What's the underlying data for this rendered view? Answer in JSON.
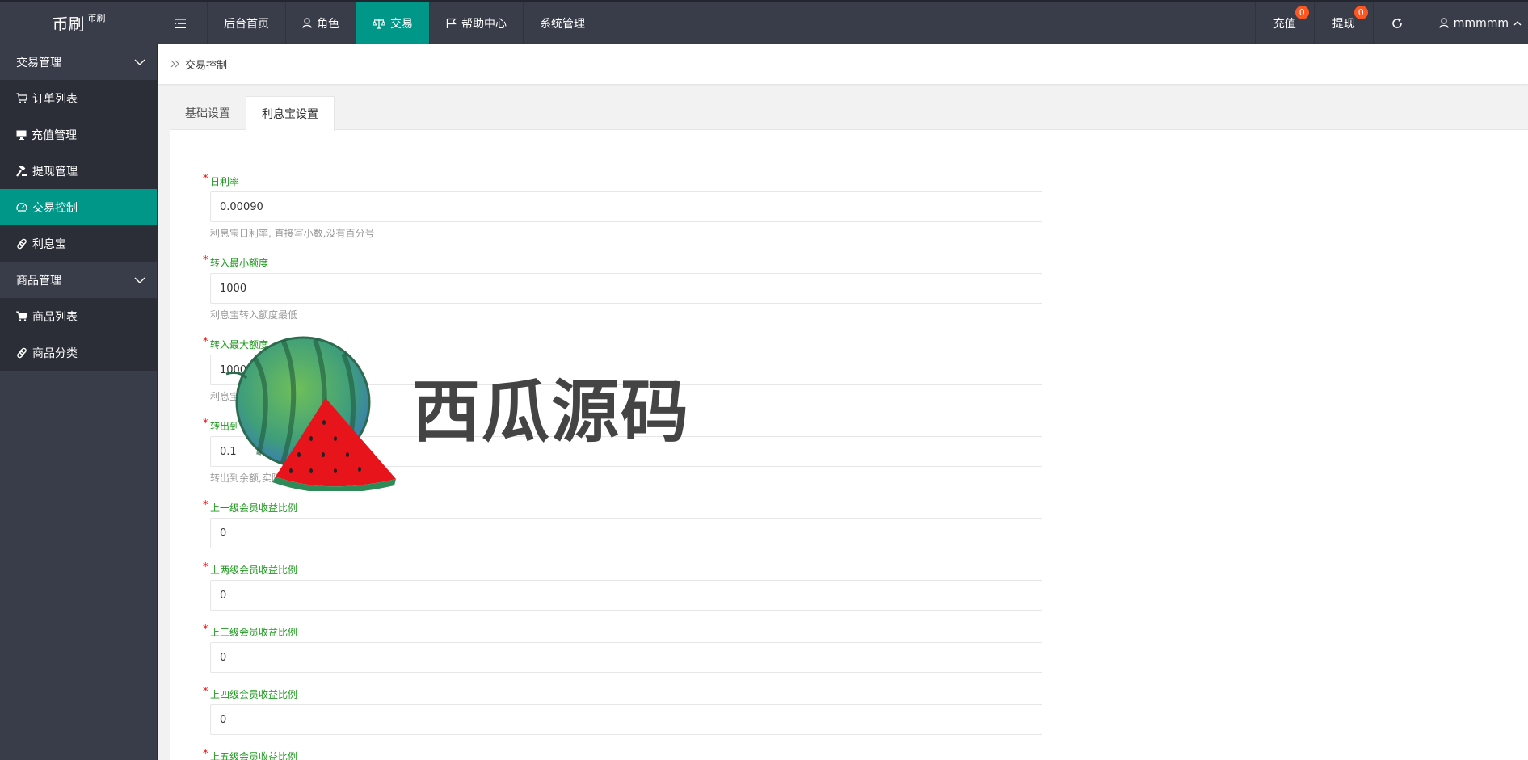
{
  "app": {
    "logo_main": "币刷",
    "logo_sup": "币刷"
  },
  "topnav": [
    {
      "label": "",
      "icon": "menu-fold-icon",
      "active": false
    },
    {
      "label": "后台首页",
      "icon": "",
      "active": false
    },
    {
      "label": "角色",
      "icon": "user-icon",
      "active": false
    },
    {
      "label": "交易",
      "icon": "scale-icon",
      "active": true
    },
    {
      "label": "帮助中心",
      "icon": "flag-icon",
      "active": false
    },
    {
      "label": "系统管理",
      "icon": "",
      "active": false
    }
  ],
  "topright": {
    "recharge": {
      "label": "充值",
      "badge": "0"
    },
    "withdraw": {
      "label": "提现",
      "badge": "0"
    },
    "refresh_icon": "refresh-icon",
    "user": {
      "label": "mmmmm",
      "icon": "user-icon"
    }
  },
  "sidebar": {
    "groups": [
      {
        "label": "交易管理",
        "items": [
          {
            "label": "订单列表",
            "icon": "cart-icon"
          },
          {
            "label": "充值管理",
            "icon": "monitor-icon"
          },
          {
            "label": "提现管理",
            "icon": "gavel-icon"
          },
          {
            "label": "交易控制",
            "icon": "dashboard-icon",
            "active": true
          },
          {
            "label": "利息宝",
            "icon": "link-icon"
          }
        ]
      },
      {
        "label": "商品管理",
        "items": [
          {
            "label": "商品列表",
            "icon": "cart-filled-icon"
          },
          {
            "label": "商品分类",
            "icon": "link-icon"
          }
        ]
      }
    ]
  },
  "breadcrumb": {
    "label": "交易控制"
  },
  "tabs": [
    {
      "label": "基础设置",
      "active": false
    },
    {
      "label": "利息宝设置",
      "active": true
    }
  ],
  "form": {
    "fields": [
      {
        "label": "日利率",
        "value": "0.00090",
        "hint": "利息宝日利率, 直接写小数,没有百分号"
      },
      {
        "label": "转入最小额度",
        "value": "1000",
        "hint": "利息宝转入额度最低"
      },
      {
        "label": "转入最大额度",
        "value": "100000",
        "hint": "利息宝"
      },
      {
        "label": "转出到",
        "value": "0.1",
        "hint": "转出到余额,实际到"
      },
      {
        "label": "上一级会员收益比例",
        "value": "0",
        "hint": ""
      },
      {
        "label": "上两级会员收益比例",
        "value": "0",
        "hint": ""
      },
      {
        "label": "上三级会员收益比例",
        "value": "0",
        "hint": ""
      },
      {
        "label": "上四级会员收益比例",
        "value": "0",
        "hint": ""
      },
      {
        "label": "上五级会员收益比例",
        "value": "",
        "hint": ""
      }
    ]
  },
  "watermark": {
    "text": "西瓜源码"
  },
  "colors": {
    "topbar": "#393d49",
    "accent": "#009688",
    "label_green": "#1e9a1e",
    "badge": "#ff5722"
  }
}
